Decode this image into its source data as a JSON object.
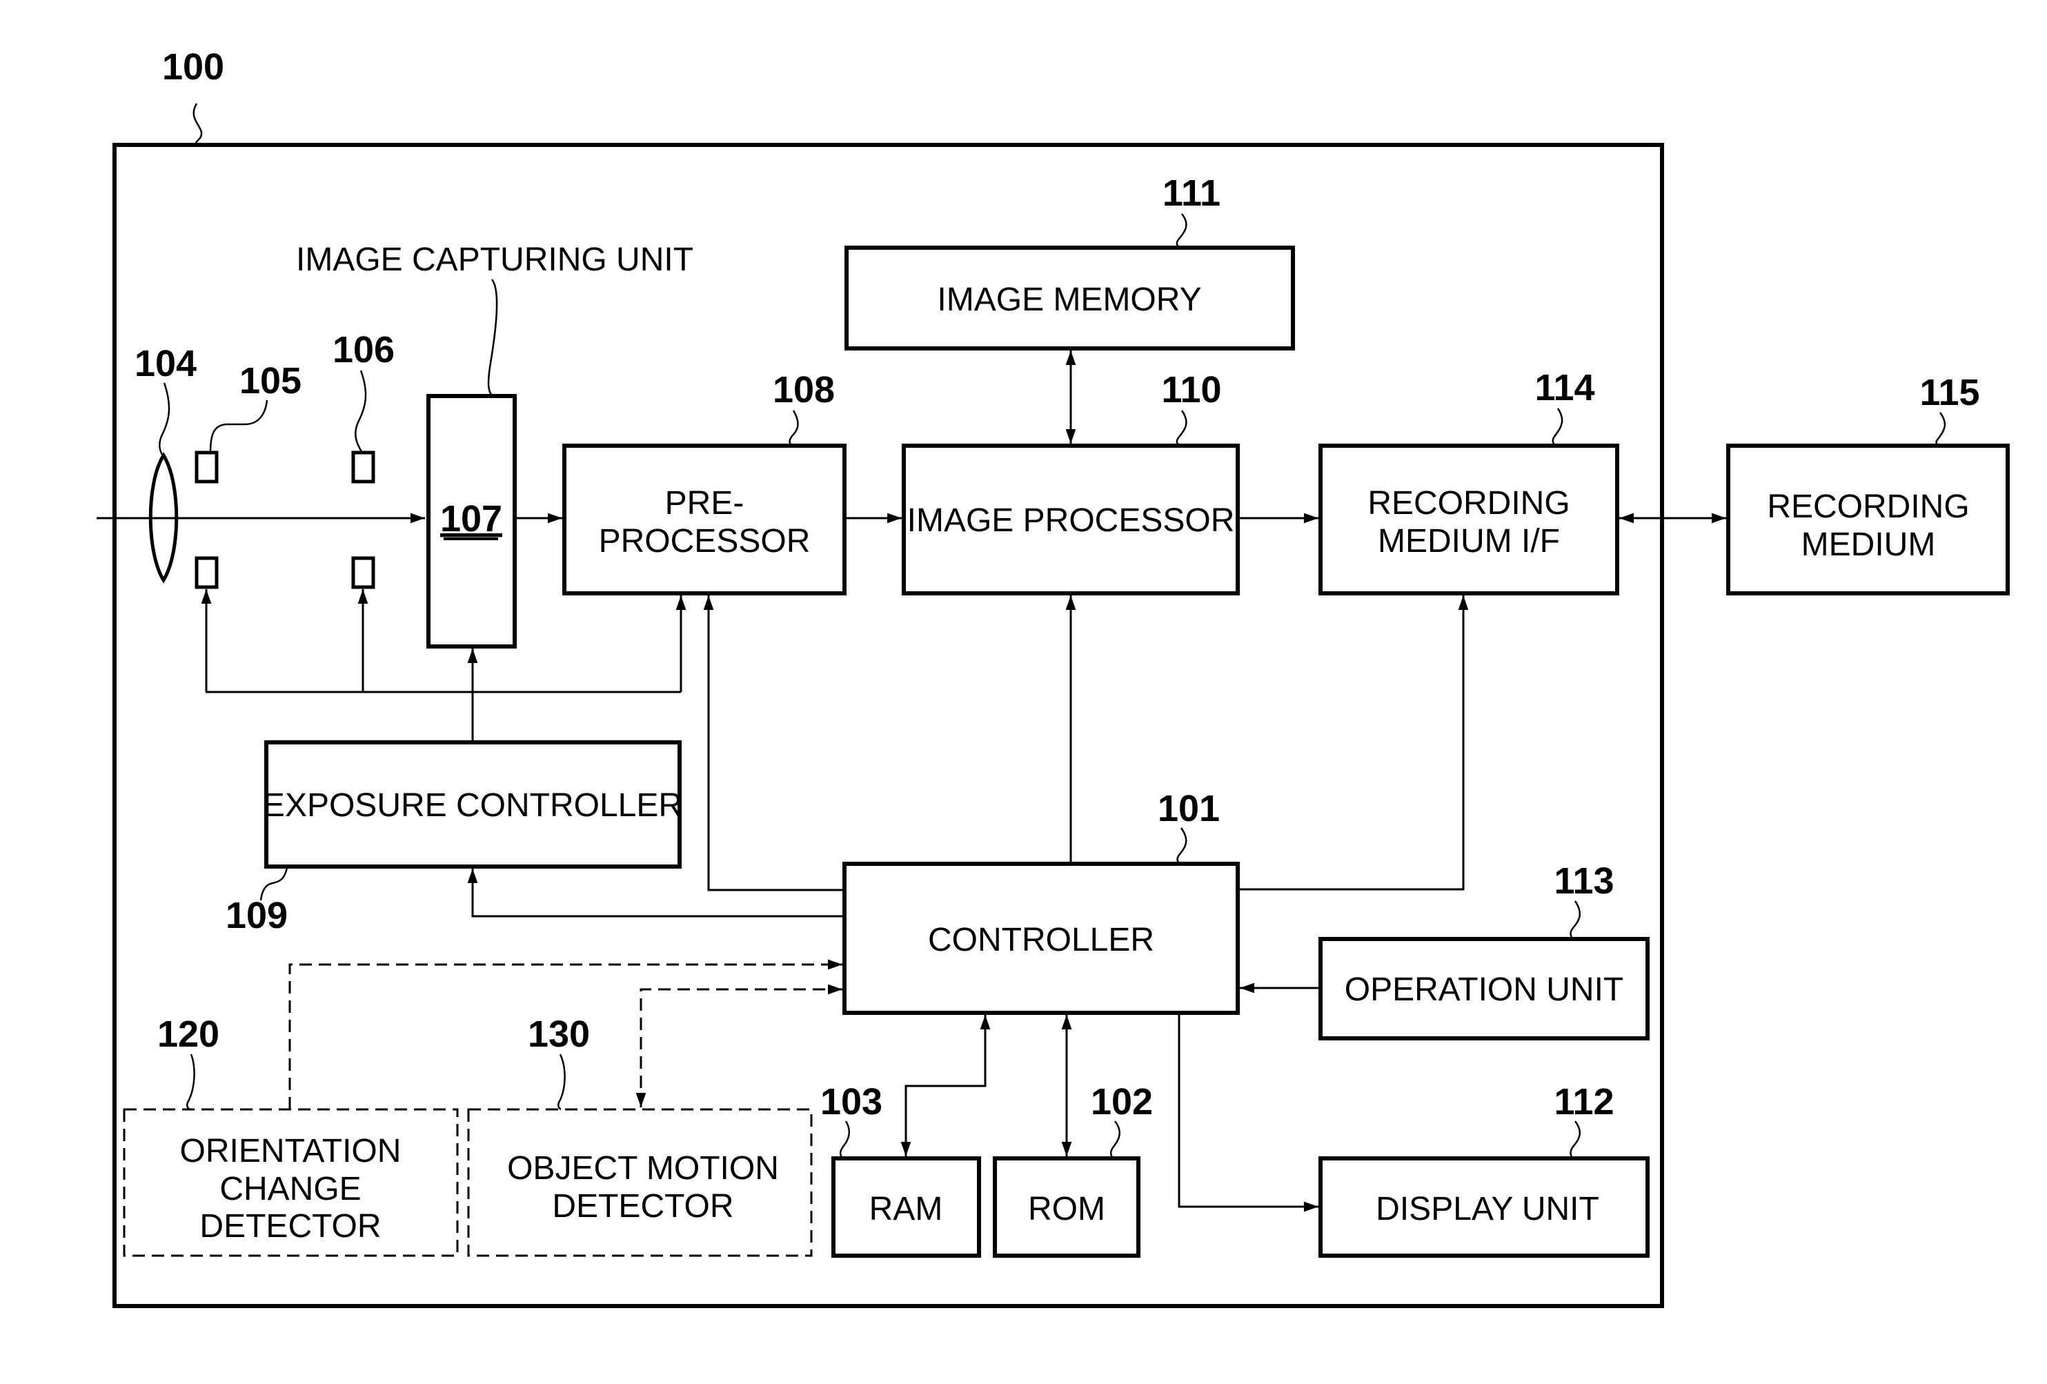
{
  "figure": {
    "system_ref": "100",
    "image_capturing_unit_label": "IMAGE CAPTURING UNIT",
    "blocks": {
      "controller": {
        "ref": "101",
        "label": "CONTROLLER"
      },
      "rom": {
        "ref": "102",
        "label": "ROM"
      },
      "ram": {
        "ref": "103",
        "label": "RAM"
      },
      "lens": {
        "ref": "104"
      },
      "aperture_a": {
        "ref": "105"
      },
      "aperture_b": {
        "ref": "106"
      },
      "sensor": {
        "ref": "107"
      },
      "pre_processor": {
        "ref": "108",
        "line1": "PRE-",
        "line2": "PROCESSOR"
      },
      "exposure_controller": {
        "ref": "109",
        "label": "EXPOSURE CONTROLLER"
      },
      "image_processor": {
        "ref": "110",
        "label": "IMAGE PROCESSOR"
      },
      "image_memory": {
        "ref": "111",
        "label": "IMAGE MEMORY"
      },
      "display_unit": {
        "ref": "112",
        "label": "DISPLAY UNIT"
      },
      "operation_unit": {
        "ref": "113",
        "label": "OPERATION UNIT"
      },
      "recording_medium_if": {
        "ref": "114",
        "line1": "RECORDING",
        "line2": "MEDIUM I/F"
      },
      "recording_medium": {
        "ref": "115",
        "line1": "RECORDING",
        "line2": "MEDIUM"
      },
      "orientation_change_detector": {
        "ref": "120",
        "line1": "ORIENTATION",
        "line2": "CHANGE",
        "line3": "DETECTOR"
      },
      "object_motion_detector": {
        "ref": "130",
        "line1": "OBJECT MOTION",
        "line2": "DETECTOR"
      }
    }
  }
}
